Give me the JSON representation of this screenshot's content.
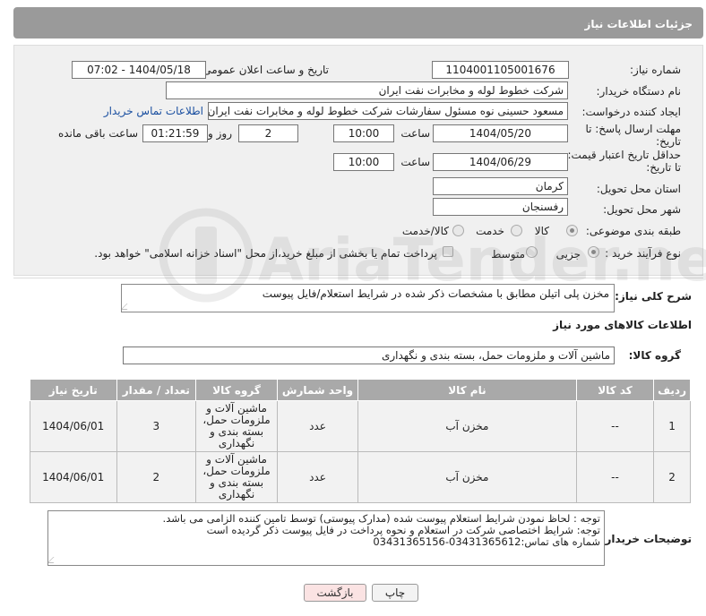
{
  "header": {
    "title": "جزئیات اطلاعات نیاز"
  },
  "form": {
    "need_number_label": "شماره نیاز:",
    "need_number": "1104001105001676",
    "announce_label": "تاریخ و ساعت اعلان عمومی:",
    "announce_value": "1404/05/18 - 07:02",
    "buyer_org_label": "نام دستگاه خریدار:",
    "buyer_org": "شرکت خطوط لوله و مخابرات نفت ایران",
    "creator_label": "ایجاد کننده درخواست:",
    "creator": "مسعود حسینی نوه  مسئول سفارشات  شرکت خطوط لوله و مخابرات نفت ایران",
    "buyer_contact_link": "اطلاعات تماس خریدار",
    "deadline_label_1": "مهلت ارسال پاسخ: تا",
    "deadline_label_2": "تاریخ:",
    "deadline_date": "1404/05/20",
    "time_label": "ساعت",
    "deadline_time": "10:00",
    "days_value": "2",
    "days_label": "روز و",
    "remaining_value": "01:21:59",
    "remaining_label": "ساعت باقی مانده",
    "validity_label_1": "حداقل تاریخ اعتبار قیمت:",
    "validity_label_2": "تا تاریخ:",
    "validity_date": "1404/06/29",
    "validity_time": "10:00",
    "province_label": "استان محل تحویل:",
    "province": "کرمان",
    "city_label": "شهر محل تحویل:",
    "city": "رفسنجان",
    "category_label": "طبقه بندی موضوعی:",
    "category_options": [
      "کالا",
      "خدمت",
      "کالا/خدمت"
    ],
    "process_label": "نوع فرآیند خرید :",
    "process_options": [
      "جزیی",
      "متوسط"
    ],
    "treasury_note": "پرداخت تمام یا بخشی از مبلغ خرید،از محل \"اسناد خزانه اسلامی\" خواهد بود."
  },
  "description": {
    "label": "شرح کلی نیاز:",
    "text": "مخزن پلی اتیلن مطابق با مشخصات ذکر شده در شرایط استعلام/فایل پیوست"
  },
  "goods_section": {
    "title": "اطلاعات کالاهای مورد نیاز",
    "group_label": "گروه کالا:",
    "group_value": "ماشین آلات و ملزومات حمل، بسته بندی و نگهداری"
  },
  "table": {
    "headers": [
      "ردیف",
      "کد کالا",
      "نام کالا",
      "واحد شمارش",
      "گروه کالا",
      "تعداد / مقدار",
      "تاریخ نیاز"
    ],
    "rows": [
      [
        "1",
        "--",
        "مخزن آب",
        "عدد",
        "ماشین آلات و ملزومات حمل، بسته بندی و نگهداری",
        "3",
        "1404/06/01"
      ],
      [
        "2",
        "--",
        "مخزن آب",
        "عدد",
        "ماشین آلات و ملزومات حمل، بسته بندی و نگهداری",
        "2",
        "1404/06/01"
      ]
    ]
  },
  "buyer_notes": {
    "label": "توضیحات خریدار:",
    "lines": [
      "توجه : لحاظ نمودن شرایط استعلام پیوست شده (مدارک پیوستی) توسط تامین کننده الزامی می باشد.",
      "توجه: شرایط اختصاصی شرکت در استعلام و نحوه پرداخت در فایل پیوست ذکر گردیده است",
      "شماره های تماس:03431365612-03431365156"
    ]
  },
  "buttons": {
    "print": "چاپ",
    "back": "بازگشت"
  },
  "watermark": {
    "text": "AriaTender.net"
  }
}
